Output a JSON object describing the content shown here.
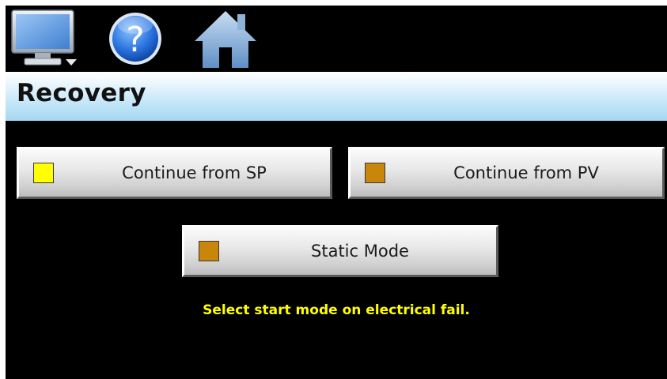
{
  "toolbar": {
    "icons": [
      {
        "name": "monitor-icon"
      },
      {
        "name": "help-icon",
        "glyph": "?"
      },
      {
        "name": "home-icon"
      }
    ]
  },
  "header": {
    "title": "Recovery"
  },
  "options": [
    {
      "label": "Continue from SP",
      "selected": true,
      "indicator_color": "#ffff00"
    },
    {
      "label": "Continue from PV",
      "selected": false,
      "indicator_color": "#c8860a"
    },
    {
      "label": "Static Mode",
      "selected": false,
      "indicator_color": "#c8860a"
    }
  ],
  "status": {
    "message": "Select start mode on electrical fail."
  },
  "colors": {
    "background": "#000000",
    "status_text": "#ffff00",
    "indicator_on": "#ffff00",
    "indicator_off": "#c8860a"
  }
}
